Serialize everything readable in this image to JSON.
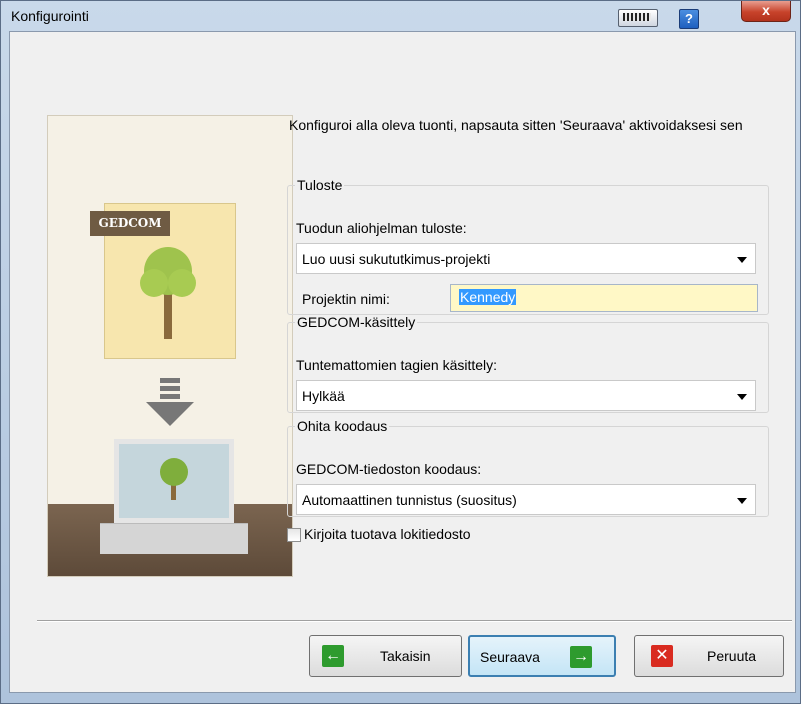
{
  "window": {
    "title": "Konfigurointi",
    "close_glyph": "x",
    "help_glyph": "?"
  },
  "illustration": {
    "doc_label": "GEDCOM"
  },
  "instruction": "Konfiguroi alla oleva tuonti, napsauta sitten 'Seuraava' aktivoidaksesi sen",
  "output_group": {
    "legend": "Tuloste",
    "label": "Tuodun aliohjelman tuloste:",
    "selected": "Luo uusi sukututkimus-projekti",
    "name_label": "Projektin nimi:",
    "name_value": "Kennedy"
  },
  "gedcom_group": {
    "legend": "GEDCOM-käsittely",
    "label": "Tuntemattomien tagien käsittely:",
    "selected": "Hylkää"
  },
  "encoding_group": {
    "legend": "Ohita koodaus",
    "label": "GEDCOM-tiedoston koodaus:",
    "selected": "Automaattinen tunnistus (suositus)"
  },
  "log_checkbox": {
    "label": "Kirjoita tuotava lokitiedosto",
    "checked": false
  },
  "buttons": {
    "back": "Takaisin",
    "next": "Seuraava",
    "cancel": "Peruuta"
  },
  "colors": {
    "accent_green": "#2e9b2e",
    "cancel_red": "#d92b20",
    "name_field_bg": "#fff8c6",
    "selection": "#3399ff"
  },
  "icons": [
    "keyboard-icon",
    "help-icon",
    "close-icon",
    "back-arrow-icon",
    "next-arrow-icon",
    "cancel-x-icon",
    "tree-icon",
    "down-arrow-icon",
    "laptop-icon"
  ]
}
